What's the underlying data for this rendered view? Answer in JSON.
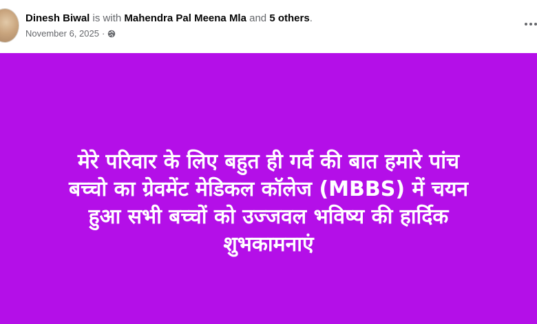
{
  "post": {
    "author": "Dinesh Biwal",
    "with_text": "is with",
    "tagged_name": "Mahendra Pal Meena Mla",
    "and_text": "and",
    "others_text": "5 others",
    "trailing_punctuation": ".",
    "date": "November 6, 2025",
    "date_separator": "·",
    "audience_icon": "globe-icon",
    "menu_icon": "more-options-icon"
  },
  "status": {
    "background_color": "#b40fe8",
    "text_color": "#ffffff",
    "lines": [
      "मेरे परिवार के लिए बहुत ही गर्व की बात हमारे पांच",
      "बच्चो का ग्रेवमेंट मेडिकल कॉलेज (MBBS) में चयन",
      "हुआ सभी बच्चों को उज्जवल भविष्य की हार्दिक",
      "शुभकामनाएं"
    ]
  }
}
